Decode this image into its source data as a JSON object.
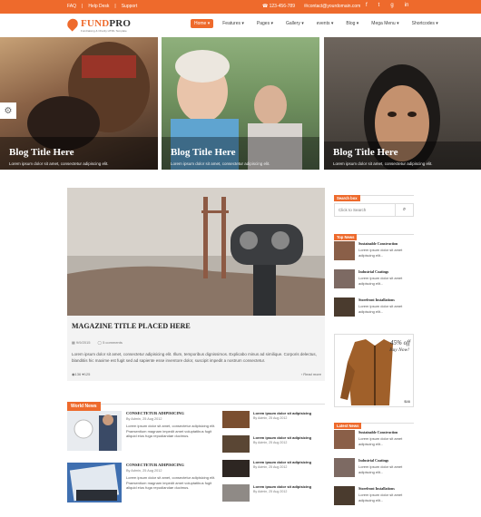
{
  "topbar": {
    "links": [
      "FAQ",
      "Help Desk",
      "Support"
    ],
    "phone": "123-456-789",
    "email": "contact@yourdomain.com",
    "social_icons": [
      "facebook-icon",
      "twitter-icon",
      "googleplus-icon",
      "linkedin-icon"
    ]
  },
  "brand": {
    "name_a": "FUND",
    "name_b": "PRO",
    "tagline": "Fundraising & Charity HTML Template"
  },
  "nav": {
    "items": [
      "Home",
      "Features",
      "Pages",
      "Gallery",
      "events",
      "Blog",
      "Mega Menu",
      "Shortcodes"
    ]
  },
  "hero": {
    "cards": [
      {
        "title": "Blog Title Here",
        "desc": "Lorem ipsum dolor sit amet, consectetur adipiscing elit."
      },
      {
        "title": "Blog Title Here",
        "desc": "Lorem ipsum dolor sit amet, consectetur adipiscing elit."
      },
      {
        "title": "Blog Title Here",
        "desc": "Lorem ipsum dolor sit amet, consectetur adipiscing elit."
      }
    ]
  },
  "main_post": {
    "title": "MAGAZINE TITLE PLACED HERE",
    "date": "9/9/2015",
    "comments": "5 comments",
    "excerpt": "Lorem ipsum dolor sit amet, consectetur adipisicing elit. Illum, temporibus dignissimos. Explicabo minus ad similique. Corporis delectus, blanditiis hic maxime est fugit sed ad sapiente esse inventore dolor, suscipit impedit a nostrum consectetur.",
    "views": "136",
    "likes": "125",
    "read_more": "Read more"
  },
  "world_news": {
    "heading": "World News",
    "left": [
      {
        "title": "CONSECTETUR ADIPISICING",
        "meta": "By Admin, 25 Aug 2012",
        "excerpt": "Lorem ipsum dolor sit amet, consectetur adipisicing elit. Praesentium magnam impedit amet voluptatibus fugit aliquid eius fuga repudiandae ducimus."
      },
      {
        "title": "CONSECTETUR ADIPISICING",
        "meta": "By Admin, 25 Aug 2012",
        "excerpt": "Lorem ipsum dolor sit amet, consectetur adipisicing elit. Praesentium magnam impedit amet voluptatibus fugit aliquid eius fuga repudiandae ducimus."
      }
    ],
    "right": [
      {
        "title": "Lorem ipsum dolor sit adipisicing",
        "meta": "By Admin, 25 Aug 2012"
      },
      {
        "title": "Lorem ipsum dolor sit adipisicing",
        "meta": "By Admin, 25 Aug 2012"
      },
      {
        "title": "Lorem ipsum dolor sit adipisicing",
        "meta": "By Admin, 25 Aug 2012"
      },
      {
        "title": "Lorem ipsum dolor sit adipisicing",
        "meta": "By Admin, 25 Aug 2012"
      }
    ]
  },
  "sidebar": {
    "search_heading": "Search box",
    "search_placeholder": "Click to Search",
    "top_news_heading": "Top News",
    "top_news": [
      {
        "title": "Sustainable Construction",
        "excerpt": "Lorem ipsum dolor sit amet adipiscing elit..."
      },
      {
        "title": "Industrial Coatings",
        "excerpt": "Lorem ipsum dolor sit amet adipiscing elit..."
      },
      {
        "title": "Storefront Installations",
        "excerpt": "Lorem ipsum dolor sit amet adipiscing elit..."
      }
    ],
    "ad": {
      "offer": "45% off",
      "cta": "Buy Now!",
      "price": "$46"
    },
    "latest_news_heading": "Latest News",
    "latest_news": [
      {
        "title": "Sustainable Construction",
        "excerpt": "Lorem ipsum dolor sit amet adipiscing elit..."
      },
      {
        "title": "Industrial Coatings",
        "excerpt": "Lorem ipsum dolor sit amet adipiscing elit..."
      },
      {
        "title": "Storefront Installations",
        "excerpt": "Lorem ipsum dolor sit amet adipiscing elit..."
      }
    ]
  },
  "colors": {
    "accent": "#ee6a2c"
  }
}
